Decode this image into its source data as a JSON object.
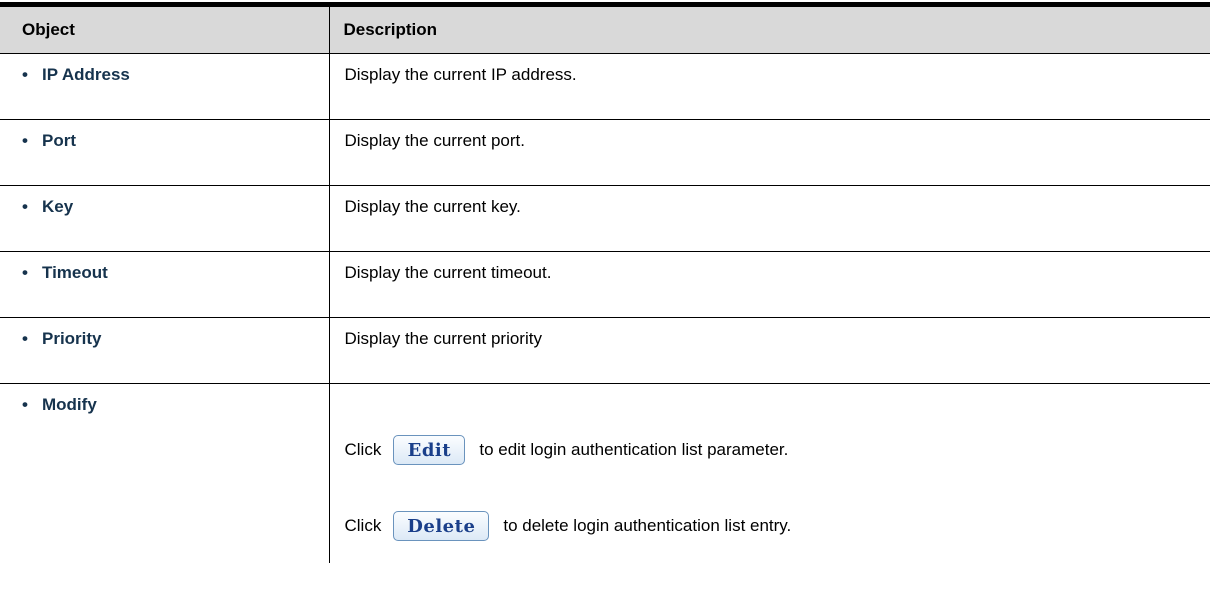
{
  "headers": {
    "object": "Object",
    "description": "Description"
  },
  "bullet": "•",
  "rows": [
    {
      "object": "IP Address",
      "description": "Display the current IP address."
    },
    {
      "object": "Port",
      "description": "Display the current port."
    },
    {
      "object": "Key",
      "description": "Display the current key."
    },
    {
      "object": "Timeout",
      "description": "Display the current timeout."
    },
    {
      "object": "Priority",
      "description": "Display the current priority"
    }
  ],
  "modify": {
    "object": "Modify",
    "edit_line": {
      "prefix": "Click",
      "button_label": "Edit",
      "suffix": "to edit login authentication list parameter."
    },
    "delete_line": {
      "prefix": "Click",
      "button_label": "Delete",
      "suffix": "to delete login authentication list entry."
    }
  },
  "colors": {
    "header_bg": "#d9d9d9",
    "object_text": "#16334d",
    "button_text": "#1a3f8a",
    "button_border": "#6a93bd"
  }
}
